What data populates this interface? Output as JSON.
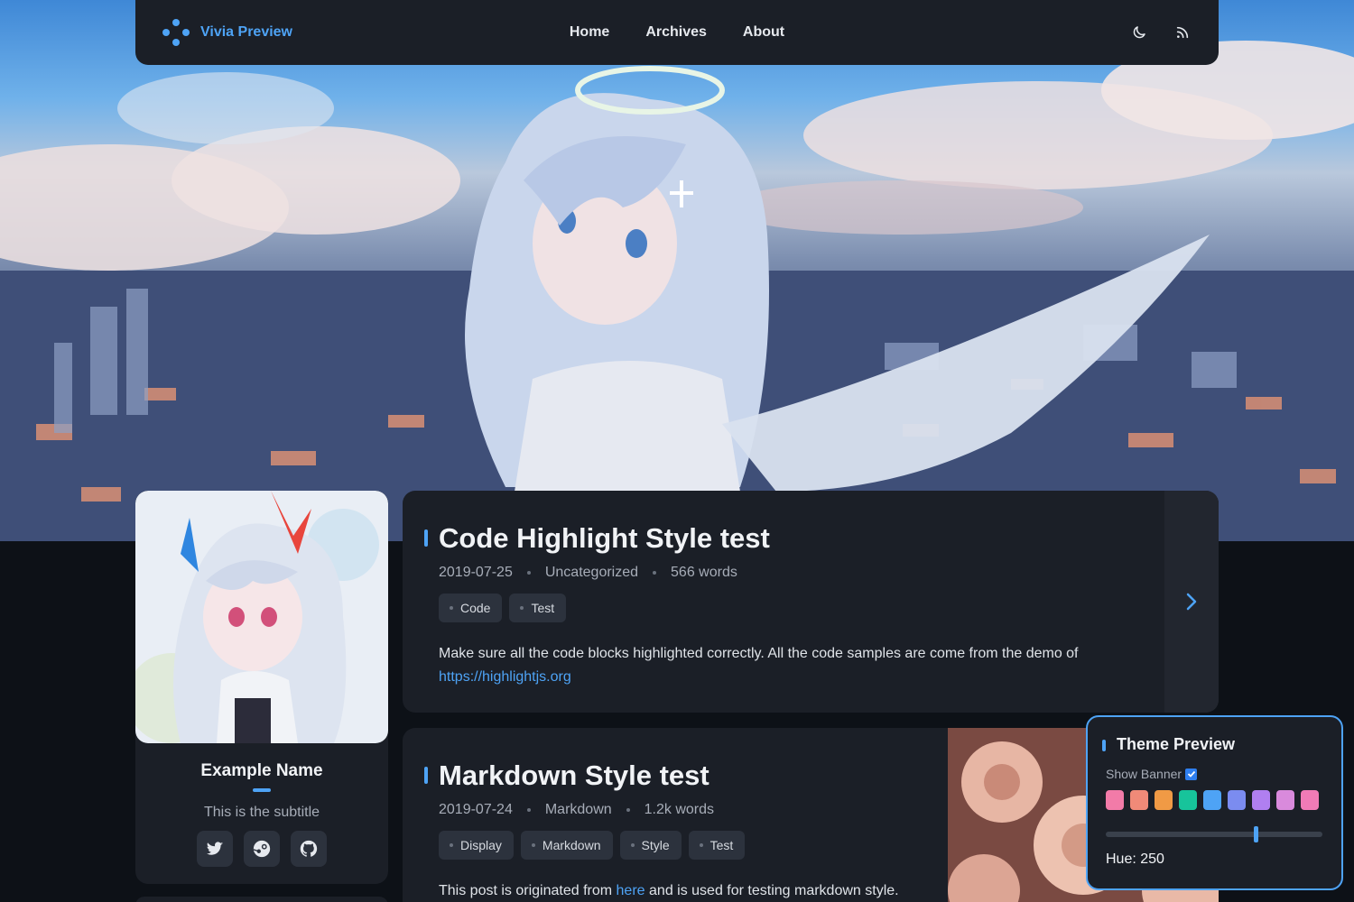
{
  "nav": {
    "brand": "Vivia Preview",
    "links": [
      "Home",
      "Archives",
      "About"
    ],
    "icons": [
      "moon-icon",
      "rss-icon"
    ]
  },
  "profile": {
    "name": "Example Name",
    "subtitle": "This is the subtitle",
    "socials": [
      "twitter-icon",
      "steam-icon",
      "github-icon"
    ]
  },
  "posts": [
    {
      "title": "Code Highlight Style test",
      "date": "2019-07-25",
      "category": "Uncategorized",
      "words": "566 words",
      "tags": [
        "Code",
        "Test"
      ],
      "excerpt": "Make sure all the code blocks highlighted correctly. All the code samples are come from the demo of",
      "link": "https://highlightjs.org"
    },
    {
      "title": "Markdown Style test",
      "date": "2019-07-24",
      "category": "Markdown",
      "words": "1.2k words",
      "tags": [
        "Display",
        "Markdown",
        "Style",
        "Test"
      ],
      "excerpt_before": "This post is originated from",
      "excerpt_link": "here",
      "excerpt_after": "and is used for testing markdown style."
    }
  ],
  "theme_panel": {
    "title": "Theme Preview",
    "show_banner_label": "Show Banner",
    "show_banner_checked": true,
    "swatches": [
      "#f27ba8",
      "#f08a78",
      "#f09a45",
      "#17c49b",
      "#4ea3f5",
      "#7b8cf0",
      "#b07ff0",
      "#d98adc",
      "#f07bb6"
    ],
    "hue_label": "Hue: 250",
    "hue_value": 250,
    "hue_max": 360
  },
  "colors": {
    "accent": "#4ea3f5",
    "card": "#1b1f27",
    "page": "#0d1117"
  }
}
